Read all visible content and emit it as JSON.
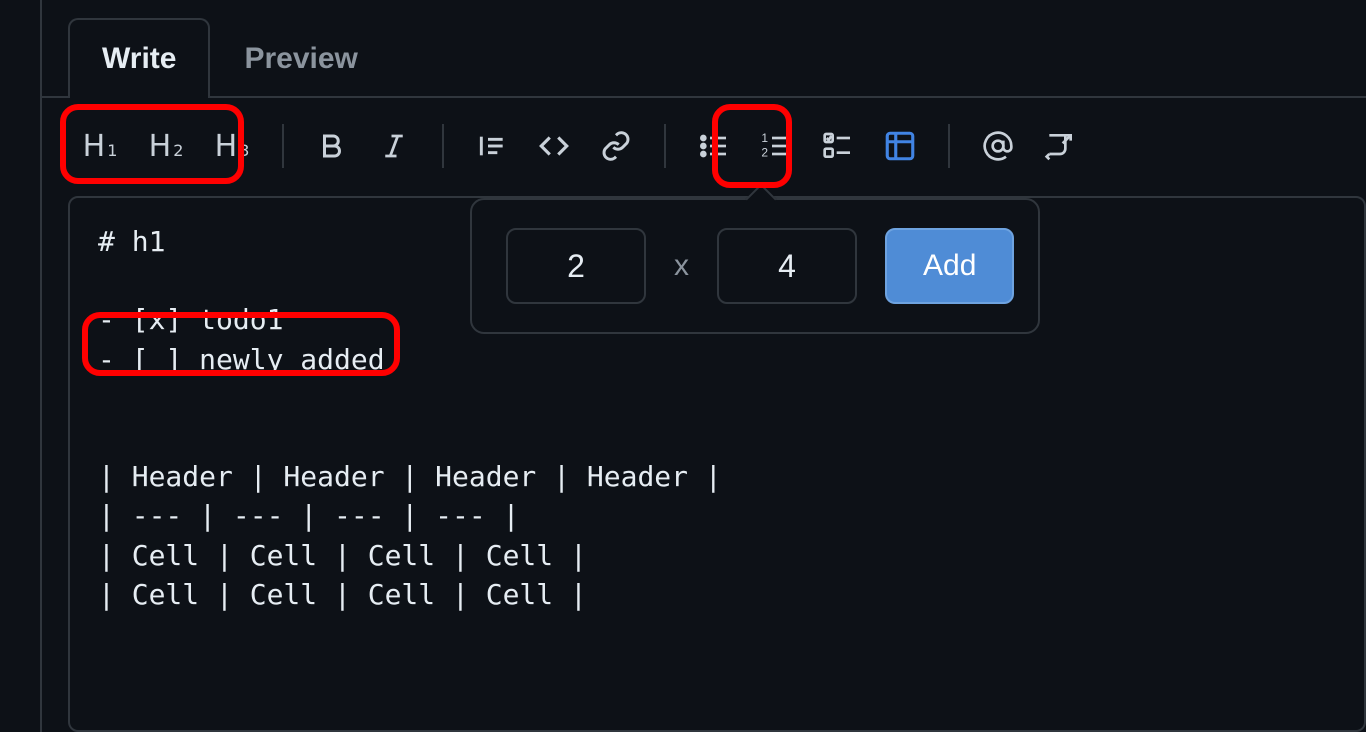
{
  "tabs": {
    "write": "Write",
    "preview": "Preview",
    "active": "write"
  },
  "toolbar": {
    "h1": "H",
    "h1sub": "1",
    "h2": "H",
    "h2sub": "2",
    "h3": "H",
    "h3sub": "3"
  },
  "popover": {
    "rows": "2",
    "separator": "x",
    "cols": "4",
    "add_label": "Add"
  },
  "editor": {
    "content": "# h1\n\n- [x] todo1\n- [ ] newly added\n\n\n| Header | Header | Header | Header |\n| --- | --- | --- | --- |\n| Cell | Cell | Cell | Cell |\n| Cell | Cell | Cell | Cell |"
  },
  "highlights": {
    "headings": true,
    "table_button": true,
    "todo_line": true
  },
  "colors": {
    "bg": "#0d1117",
    "border": "#30363d",
    "text": "#e6edf3",
    "muted": "#8b949e",
    "accent_blue": "#4184e4",
    "button_blue": "#4f8cd6",
    "highlight_red": "#ff0000"
  }
}
